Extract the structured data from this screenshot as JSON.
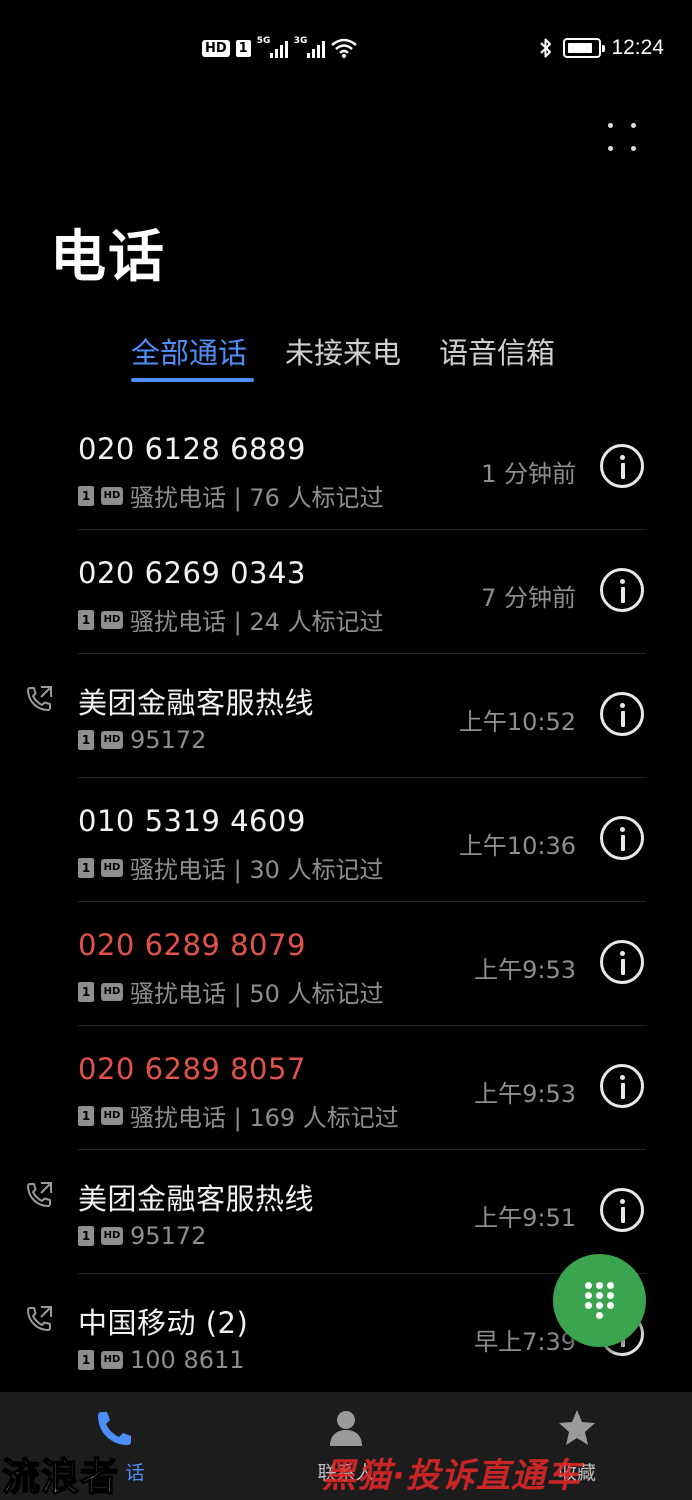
{
  "status_bar": {
    "left_badges": [
      "HD",
      "1"
    ],
    "signal_1": "5G",
    "signal_2": "3G",
    "clock": "12:24",
    "battery_level": 0.8,
    "icons": [
      "hd-icon",
      "signal-icon",
      "signal-icon",
      "wifi-icon",
      "bluetooth-icon",
      "battery-icon"
    ]
  },
  "header": {
    "title": "电话",
    "more_icon": "more-dots-icon"
  },
  "tabs": [
    {
      "label": "全部通话",
      "active": true
    },
    {
      "label": "未接来电",
      "active": false
    },
    {
      "label": "语音信箱",
      "active": false
    }
  ],
  "calls": [
    {
      "name": "020 6128 6889",
      "missed": false,
      "outgoing": false,
      "sim": "1",
      "hd": "HD",
      "detail": "骚扰电话 | 76 人标记过",
      "time": "1 分钟前"
    },
    {
      "name": "020 6269 0343",
      "missed": false,
      "outgoing": false,
      "sim": "1",
      "hd": "HD",
      "detail": "骚扰电话 | 24 人标记过",
      "time": "7 分钟前"
    },
    {
      "name": "美团金融客服热线",
      "missed": false,
      "outgoing": true,
      "sim": "1",
      "hd": "HD",
      "detail": "95172",
      "time": "上午10:52"
    },
    {
      "name": "010 5319 4609",
      "missed": false,
      "outgoing": false,
      "sim": "1",
      "hd": "HD",
      "detail": "骚扰电话 | 30 人标记过",
      "time": "上午10:36"
    },
    {
      "name": "020 6289 8079",
      "missed": true,
      "outgoing": false,
      "sim": "1",
      "hd": "HD",
      "detail": "骚扰电话 | 50 人标记过",
      "time": "上午9:53"
    },
    {
      "name": "020 6289 8057",
      "missed": true,
      "outgoing": false,
      "sim": "1",
      "hd": "HD",
      "detail": "骚扰电话 | 169 人标记过",
      "time": "上午9:53"
    },
    {
      "name": "美团金融客服热线",
      "missed": false,
      "outgoing": true,
      "sim": "1",
      "hd": "HD",
      "detail": "95172",
      "time": "上午9:51"
    },
    {
      "name": "中国移动 (2)",
      "missed": false,
      "outgoing": true,
      "sim": "1",
      "hd": "HD",
      "detail": "100 8611",
      "time": "早上7:39"
    }
  ],
  "fab": {
    "icon": "dialpad-icon"
  },
  "bottom_nav": [
    {
      "label": "话",
      "icon": "phone-icon",
      "active": true
    },
    {
      "label": "联系人",
      "icon": "contacts-icon",
      "active": false
    },
    {
      "label": "收藏",
      "icon": "star-icon",
      "active": false
    }
  ],
  "watermarks": {
    "left": "流浪者",
    "right": "黑猫·投诉直通车"
  },
  "colors": {
    "accent": "#4e8ef7",
    "missed": "#e0524a",
    "fab": "#3aa54e",
    "background": "#000000",
    "nav_background": "#1c1c1c"
  }
}
